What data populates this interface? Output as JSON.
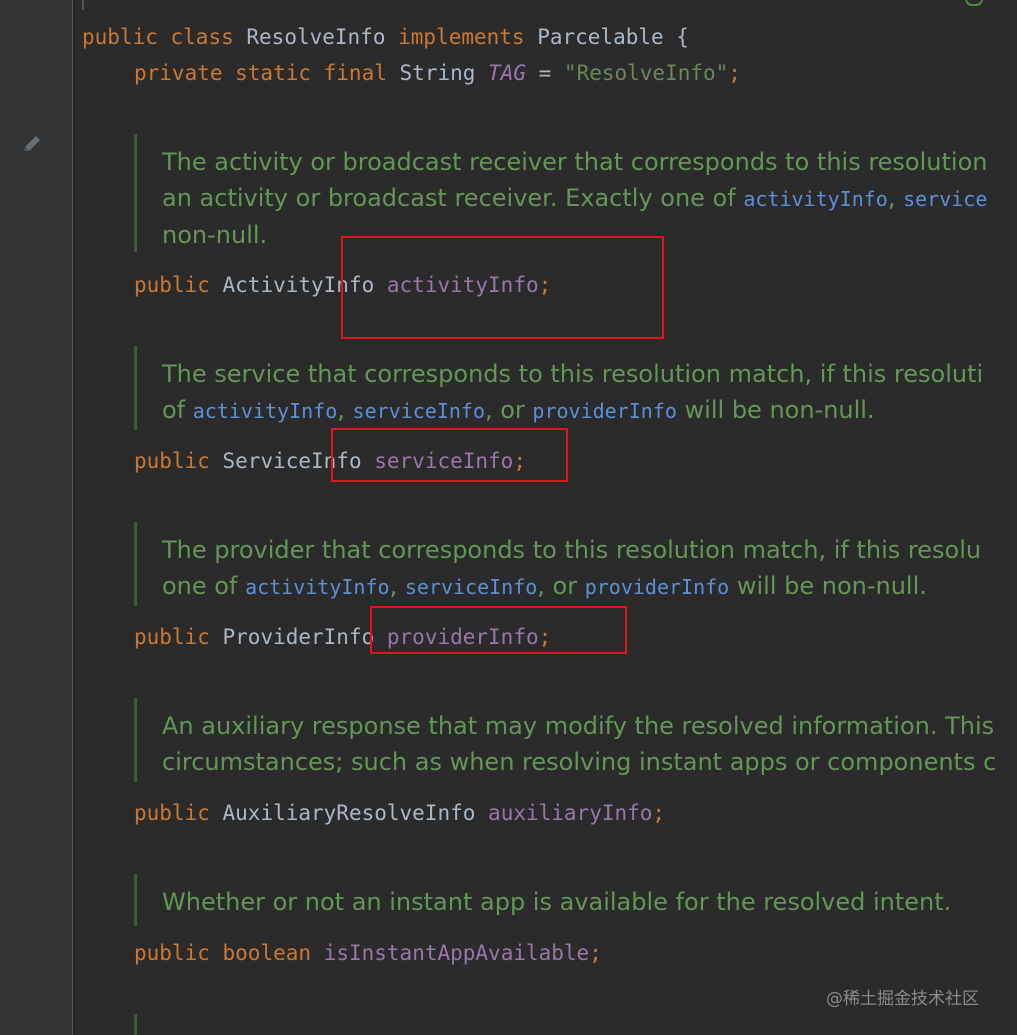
{
  "class_decl": {
    "modifier1": "public",
    "modifier2": "class",
    "name": "ResolveInfo",
    "implements": "implements",
    "interface": "Parcelable",
    "brace": " {"
  },
  "tag_field": {
    "modifiers": "private static final",
    "type": "String",
    "name": "TAG",
    "eq": " = ",
    "value": "\"ResolveInfo\"",
    "semi": ";"
  },
  "docs": {
    "activity": {
      "line1": "The activity or broadcast receiver that corresponds to this resolution",
      "line2_pre": "an activity or broadcast receiver. Exactly one of ",
      "ref1": "activityInfo",
      "comma": ", ",
      "ref2": "service",
      "line3": "non-null."
    },
    "service": {
      "line1": "The service that corresponds to this resolution match, if this resoluti",
      "line2_pre": "of ",
      "ref1": "activityInfo",
      "c1": ", ",
      "ref2": "serviceInfo",
      "c2": ", or ",
      "ref3": "providerInfo",
      "line2_post": " will be non-null."
    },
    "provider": {
      "line1": "The provider that corresponds to this resolution match, if this resolu",
      "line2_pre": "one of ",
      "ref1": "activityInfo",
      "c1": ", ",
      "ref2": "serviceInfo",
      "c2": ", or ",
      "ref3": "providerInfo",
      "line2_post": " will be non-null."
    },
    "auxiliary": {
      "line1": "An auxiliary response that may modify the resolved information. This",
      "line2": "circumstances; such as when resolving instant apps or components c"
    },
    "instant": {
      "line1": "Whether or not an instant app is available for the resolved intent."
    }
  },
  "fields": [
    {
      "modifier": "public",
      "type": "ActivityInfo",
      "name": "activityInfo",
      "semi": ";"
    },
    {
      "modifier": "public",
      "type": "ServiceInfo",
      "name": "serviceInfo",
      "semi": ";"
    },
    {
      "modifier": "public",
      "type": "ProviderInfo",
      "name": "providerInfo",
      "semi": ";"
    },
    {
      "modifier": "public",
      "type": "AuxiliaryResolveInfo",
      "name": "auxiliaryInfo",
      "semi": ";"
    },
    {
      "modifier": "public",
      "type": "boolean",
      "name": "isInstantAppAvailable",
      "semi": ";"
    }
  ],
  "watermark": "@稀土掘金技术社区",
  "icons": {
    "gutter_edit": "pencil-icon"
  },
  "colors": {
    "keyword": "#cc7832",
    "field": "#9876aa",
    "string": "#6a8759",
    "doc_text": "#629755",
    "doc_ref": "#5b8fd8",
    "highlight": "#e3141c",
    "background": "#2b2b2b"
  }
}
